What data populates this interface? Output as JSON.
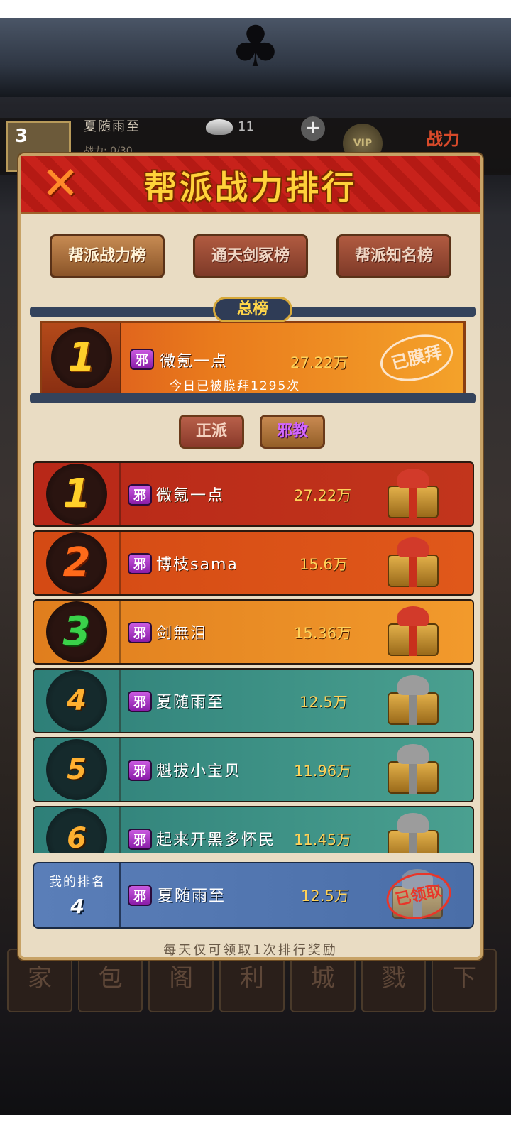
{
  "background": {
    "player_level": "3",
    "player_name": "夏随雨至",
    "power_line": "战力: 0/30",
    "silver_amount": "11",
    "vip_label": "VIP",
    "power_logo": "战力",
    "bottom_nav": [
      "家",
      "包",
      "阁",
      "利",
      "城",
      "戮",
      "下"
    ]
  },
  "modal": {
    "title": "帮派战力排行",
    "close_icon": "✕",
    "tabs": [
      {
        "label": "帮派战力榜",
        "active": true
      },
      {
        "label": "通天剑冢榜",
        "active": false
      },
      {
        "label": "帮派知名榜",
        "active": false
      }
    ],
    "overall": {
      "label": "总榜",
      "rank": "1",
      "sect": "邪",
      "name": "微氪一点",
      "power": "27.22万",
      "worship_count_text": "今日已被膜拜1295次",
      "stamp": "已膜拜"
    },
    "sect_toggle": {
      "righteous": "正派",
      "evil": "邪教",
      "selected": "evil"
    },
    "rows": [
      {
        "rank": "1",
        "sect": "邪",
        "name": "微氪一点",
        "power": "27.22万",
        "reward": "gift-red"
      },
      {
        "rank": "2",
        "sect": "邪",
        "name": "博枝sama",
        "power": "15.6万",
        "reward": "gift-red"
      },
      {
        "rank": "3",
        "sect": "邪",
        "name": "剑無泪",
        "power": "15.36万",
        "reward": "gift-red"
      },
      {
        "rank": "4",
        "sect": "邪",
        "name": "夏随雨至",
        "power": "12.5万",
        "reward": "gift-silver"
      },
      {
        "rank": "5",
        "sect": "邪",
        "name": "魁拔小宝贝",
        "power": "11.96万",
        "reward": "gift-silver"
      },
      {
        "rank": "6",
        "sect": "邪",
        "name": "起来开黑多怀民",
        "power": "11.45万",
        "reward": "gift-silver"
      }
    ],
    "my_rank": {
      "label": "我的排名",
      "rank": "4",
      "sect": "邪",
      "name": "夏随雨至",
      "power": "12.5万",
      "stamp": "已领取"
    },
    "footnote": "每天仅可领取1次排行奖励"
  },
  "colors": {
    "header_red": "#c8221b",
    "title_gold": "#ffd23a",
    "panel_bg": "#e9dcc3",
    "teal_row": "#2e7f78",
    "my_row_blue": "#5a7eb8",
    "sect_purple": "#a62cc0"
  }
}
